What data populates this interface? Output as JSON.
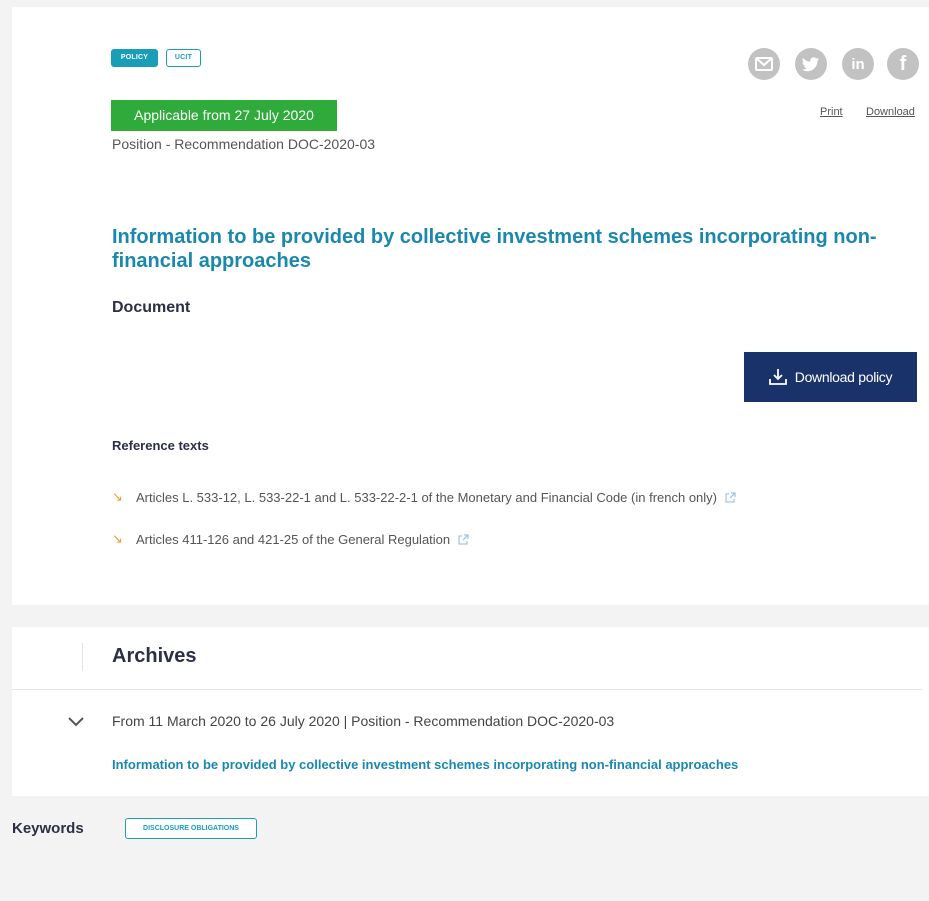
{
  "tags": {
    "primary": "POLICY",
    "secondary": "UCIT"
  },
  "social": {
    "email": "email-icon",
    "twitter": "twitter-icon",
    "linkedin": "linkedin-icon",
    "facebook": "facebook-icon"
  },
  "actions": {
    "print": "Print",
    "download": "Download"
  },
  "status_badge": "Applicable from 27 July 2020",
  "doc_type": "Position - Recommendation DOC-2020-03",
  "title": "Information to be provided by collective investment schemes incorporating non-financial approaches",
  "document_heading": "Document",
  "download_button": "Download policy",
  "reference_heading": "Reference texts",
  "references": [
    "Articles L. 533-12, L. 533-22-1 and L. 533-22-2-1 of the Monetary and Financial Code (in french only)",
    "Articles 411-126 and 421-25 of the General Regulation"
  ],
  "archives": {
    "heading": "Archives",
    "entry_line": "From 11 March 2020 to 26 July 2020 | Position - Recommendation DOC-2020-03",
    "entry_link": "Information to be provided by collective investment schemes incorporating non-financial approaches"
  },
  "keywords": {
    "label": "Keywords",
    "tag": "DISCLOSURE OBLIGATIONS"
  },
  "colors": {
    "accent": "#1a88ad",
    "badge_green": "#2fab3b",
    "button_navy": "#19336a",
    "arrow_orange": "#f39a2b"
  }
}
